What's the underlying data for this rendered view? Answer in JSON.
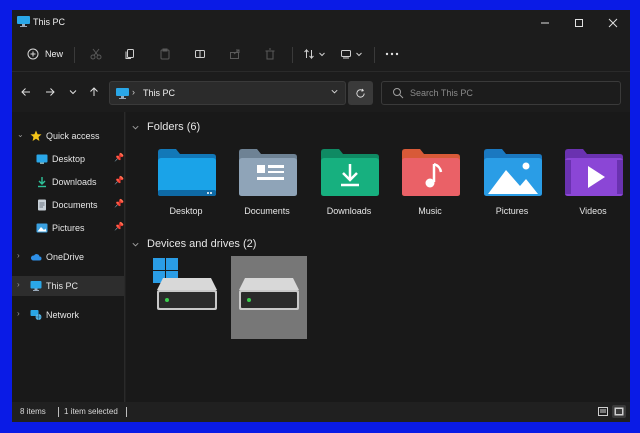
{
  "window": {
    "title": "This PC"
  },
  "titlebar": {
    "minimize_icon": "minimize-icon",
    "maximize_icon": "maximize-icon",
    "close_icon": "close-icon"
  },
  "command_bar": {
    "new_label": "New",
    "items": [
      "cut-icon",
      "copy-icon",
      "paste-icon",
      "rename-icon",
      "share-icon",
      "delete-icon",
      "sort-icon",
      "view-icon",
      "more-icon"
    ]
  },
  "navigation": {
    "address": "This PC",
    "search_placeholder": "Search This PC"
  },
  "sidebar": {
    "items": [
      {
        "label": "Quick access",
        "icon": "star-icon"
      },
      {
        "label": "Desktop",
        "icon": "desktop-icon",
        "pinned": true
      },
      {
        "label": "Downloads",
        "icon": "download-icon",
        "pinned": true
      },
      {
        "label": "Documents",
        "icon": "documents-icon",
        "pinned": true
      },
      {
        "label": "Pictures",
        "icon": "pictures-icon",
        "pinned": true
      },
      {
        "label": "OneDrive",
        "icon": "cloud-icon"
      },
      {
        "label": "This PC",
        "icon": "computer-icon",
        "selected": true
      },
      {
        "label": "Network",
        "icon": "network-icon"
      }
    ]
  },
  "main": {
    "folders_heading": "Folders (6)",
    "folders": [
      {
        "label": "Desktop",
        "color": "#1aa3e8"
      },
      {
        "label": "Documents",
        "color": "#8fa4b8"
      },
      {
        "label": "Downloads",
        "color": "#17b07f"
      },
      {
        "label": "Music",
        "color": "#f06a52"
      },
      {
        "label": "Pictures",
        "color": "#2a9de6"
      },
      {
        "label": "Videos",
        "color": "#8b46d6"
      }
    ],
    "drives_heading": "Devices and drives (2)",
    "drives": [
      {
        "name": "system-drive",
        "has_windows_logo": true,
        "selected": false
      },
      {
        "name": "drive",
        "has_windows_logo": false,
        "selected": true
      }
    ]
  },
  "status_bar": {
    "items_count": "8 items",
    "selection": "1 item selected"
  },
  "colors": {
    "accent": "#0078d4",
    "background": "#191919",
    "frame": "#0a1be6"
  }
}
